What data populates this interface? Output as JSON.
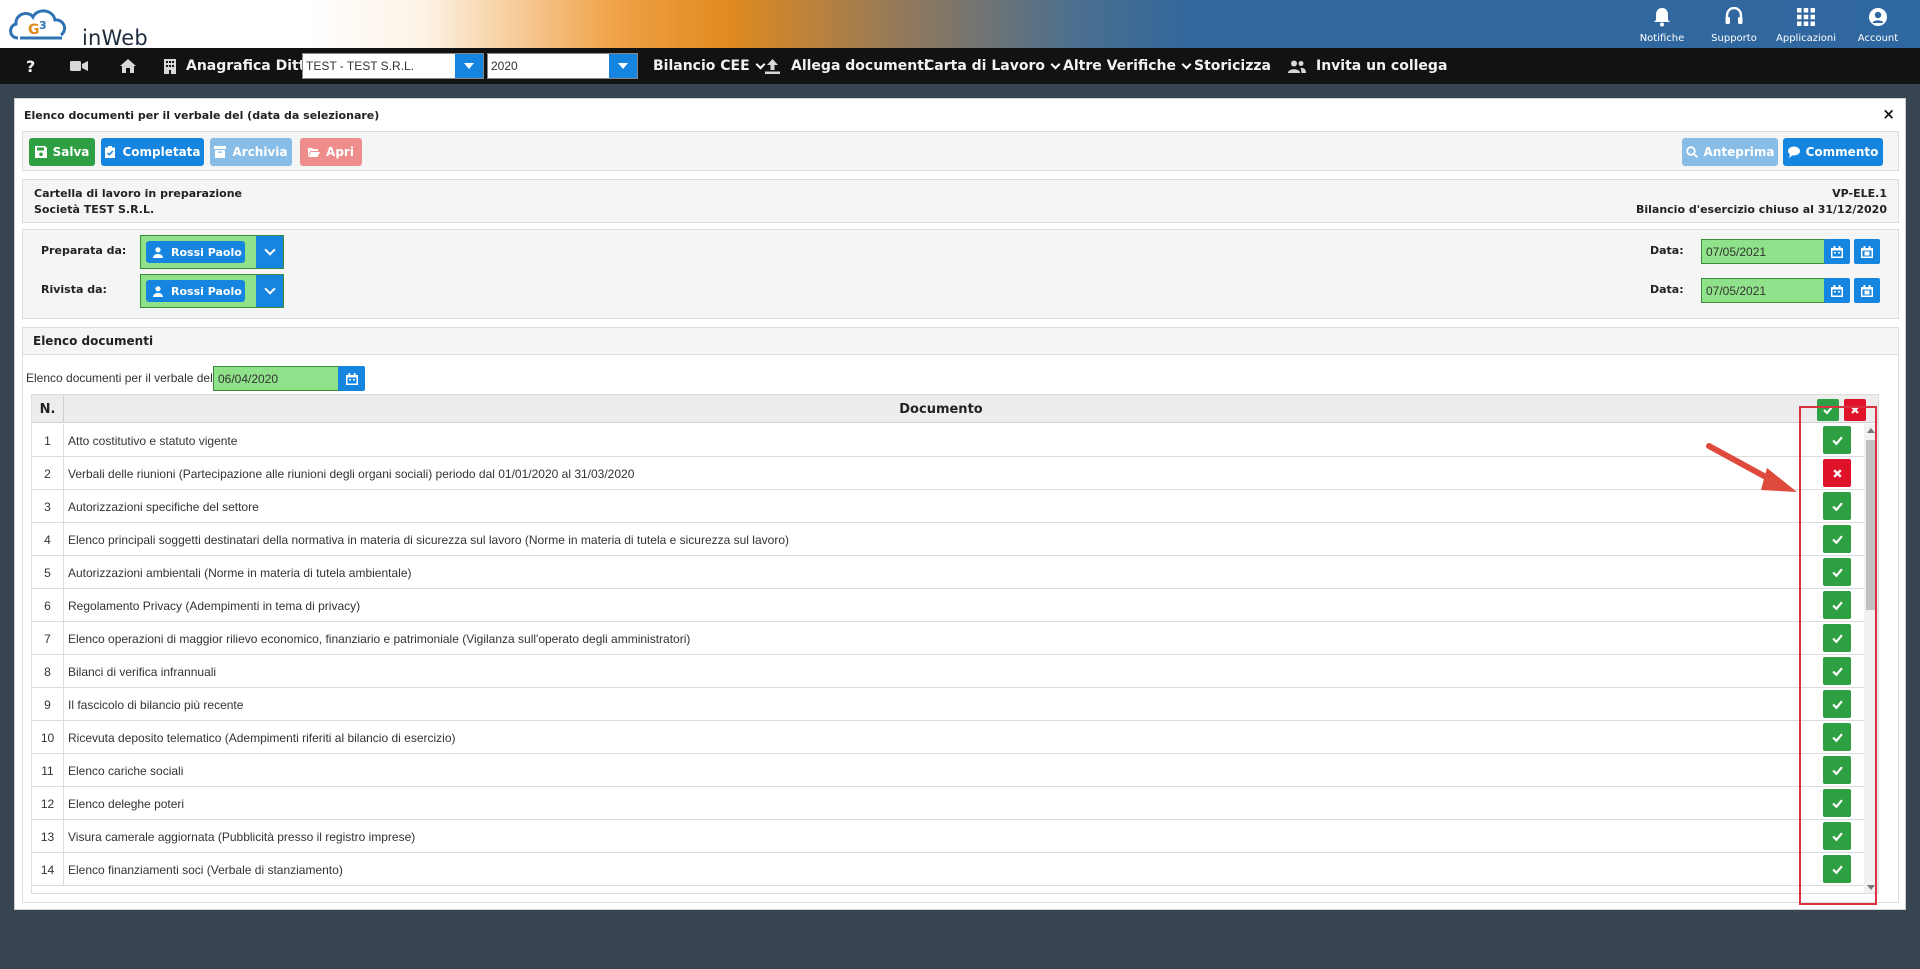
{
  "header": {
    "logo_text": "inWeb",
    "icons": [
      {
        "name": "bell-icon",
        "label": "Notifiche"
      },
      {
        "name": "headset-icon",
        "label": "Supporto"
      },
      {
        "name": "apps-grid-icon",
        "label": "Applicazioni"
      },
      {
        "name": "user-circle-icon",
        "label": "Account"
      }
    ]
  },
  "nav": {
    "help": "?",
    "anagrafica_label": "Anagrafica Ditte",
    "company_value": "TEST - TEST S.R.L.",
    "year_value": "2020",
    "bilancio_label": "Bilancio CEE",
    "allega_label": "Allega documenti",
    "carta_label": "Carta di Lavoro",
    "altre_label": "Altre Verifiche",
    "storicizza_label": "Storicizza",
    "invita_label": "Invita un collega"
  },
  "panel": {
    "title": "Elenco documenti per il verbale del (data da selezionare)",
    "close": "×"
  },
  "toolbar": {
    "salva": "Salva",
    "completata": "Completata",
    "archivia": "Archivia",
    "apri": "Apri",
    "anteprima": "Anteprima",
    "commento": "Commento"
  },
  "info": {
    "status": "Cartella di lavoro in preparazione",
    "company": "Società TEST S.R.L.",
    "code": "VP-ELE.1",
    "period": "Bilancio d'esercizio chiuso al 31/12/2020"
  },
  "people": {
    "preparata_label": "Preparata da:",
    "preparata_user": "Rossi Paolo",
    "rivista_label": "Rivista da:",
    "rivista_user": "Rossi Paolo",
    "data_label": "Data:",
    "preparata_date": "07/05/2021",
    "rivista_date": "07/05/2021"
  },
  "list": {
    "section_title": "Elenco documenti",
    "verbale_label": "Elenco documenti per il verbale del",
    "verbale_date": "06/04/2020",
    "col_n": "N.",
    "col_doc": "Documento",
    "rows": [
      {
        "n": "1",
        "doc": "Atto costitutivo e statuto vigente",
        "status": "ok"
      },
      {
        "n": "2",
        "doc": "Verbali delle riunioni (Partecipazione alle riunioni degli organi sociali) periodo dal 01/01/2020 al 31/03/2020",
        "status": "ko"
      },
      {
        "n": "3",
        "doc": "Autorizzazioni specifiche del settore",
        "status": "ok"
      },
      {
        "n": "4",
        "doc": "Elenco principali soggetti destinatari della normativa in materia di sicurezza sul lavoro (Norme in materia di tutela e sicurezza sul lavoro)",
        "status": "ok"
      },
      {
        "n": "5",
        "doc": "Autorizzazioni ambientali (Norme in materia di tutela ambientale)",
        "status": "ok"
      },
      {
        "n": "6",
        "doc": "Regolamento Privacy (Adempimenti in tema di privacy)",
        "status": "ok"
      },
      {
        "n": "7",
        "doc": "Elenco operazioni di maggior rilievo economico, finanziario e patrimoniale (Vigilanza sull'operato degli amministratori)",
        "status": "ok"
      },
      {
        "n": "8",
        "doc": "Bilanci di verifica infrannuali",
        "status": "ok"
      },
      {
        "n": "9",
        "doc": "Il fascicolo di bilancio più recente",
        "status": "ok"
      },
      {
        "n": "10",
        "doc": "Ricevuta deposito telematico (Adempimenti riferiti al bilancio di esercizio)",
        "status": "ok"
      },
      {
        "n": "11",
        "doc": "Elenco cariche sociali",
        "status": "ok"
      },
      {
        "n": "12",
        "doc": "Elenco deleghe poteri",
        "status": "ok"
      },
      {
        "n": "13",
        "doc": "Visura camerale aggiornata (Pubblicità presso il registro imprese)",
        "status": "ok"
      },
      {
        "n": "14",
        "doc": "Elenco finanziamenti soci (Verbale di stanziamento)",
        "status": "ok"
      }
    ]
  },
  "colors": {
    "primary": "#1685e0",
    "success": "#2ea043",
    "danger": "#e0122a",
    "field_green": "#90e28a",
    "annotation_red": "#d9333f"
  }
}
